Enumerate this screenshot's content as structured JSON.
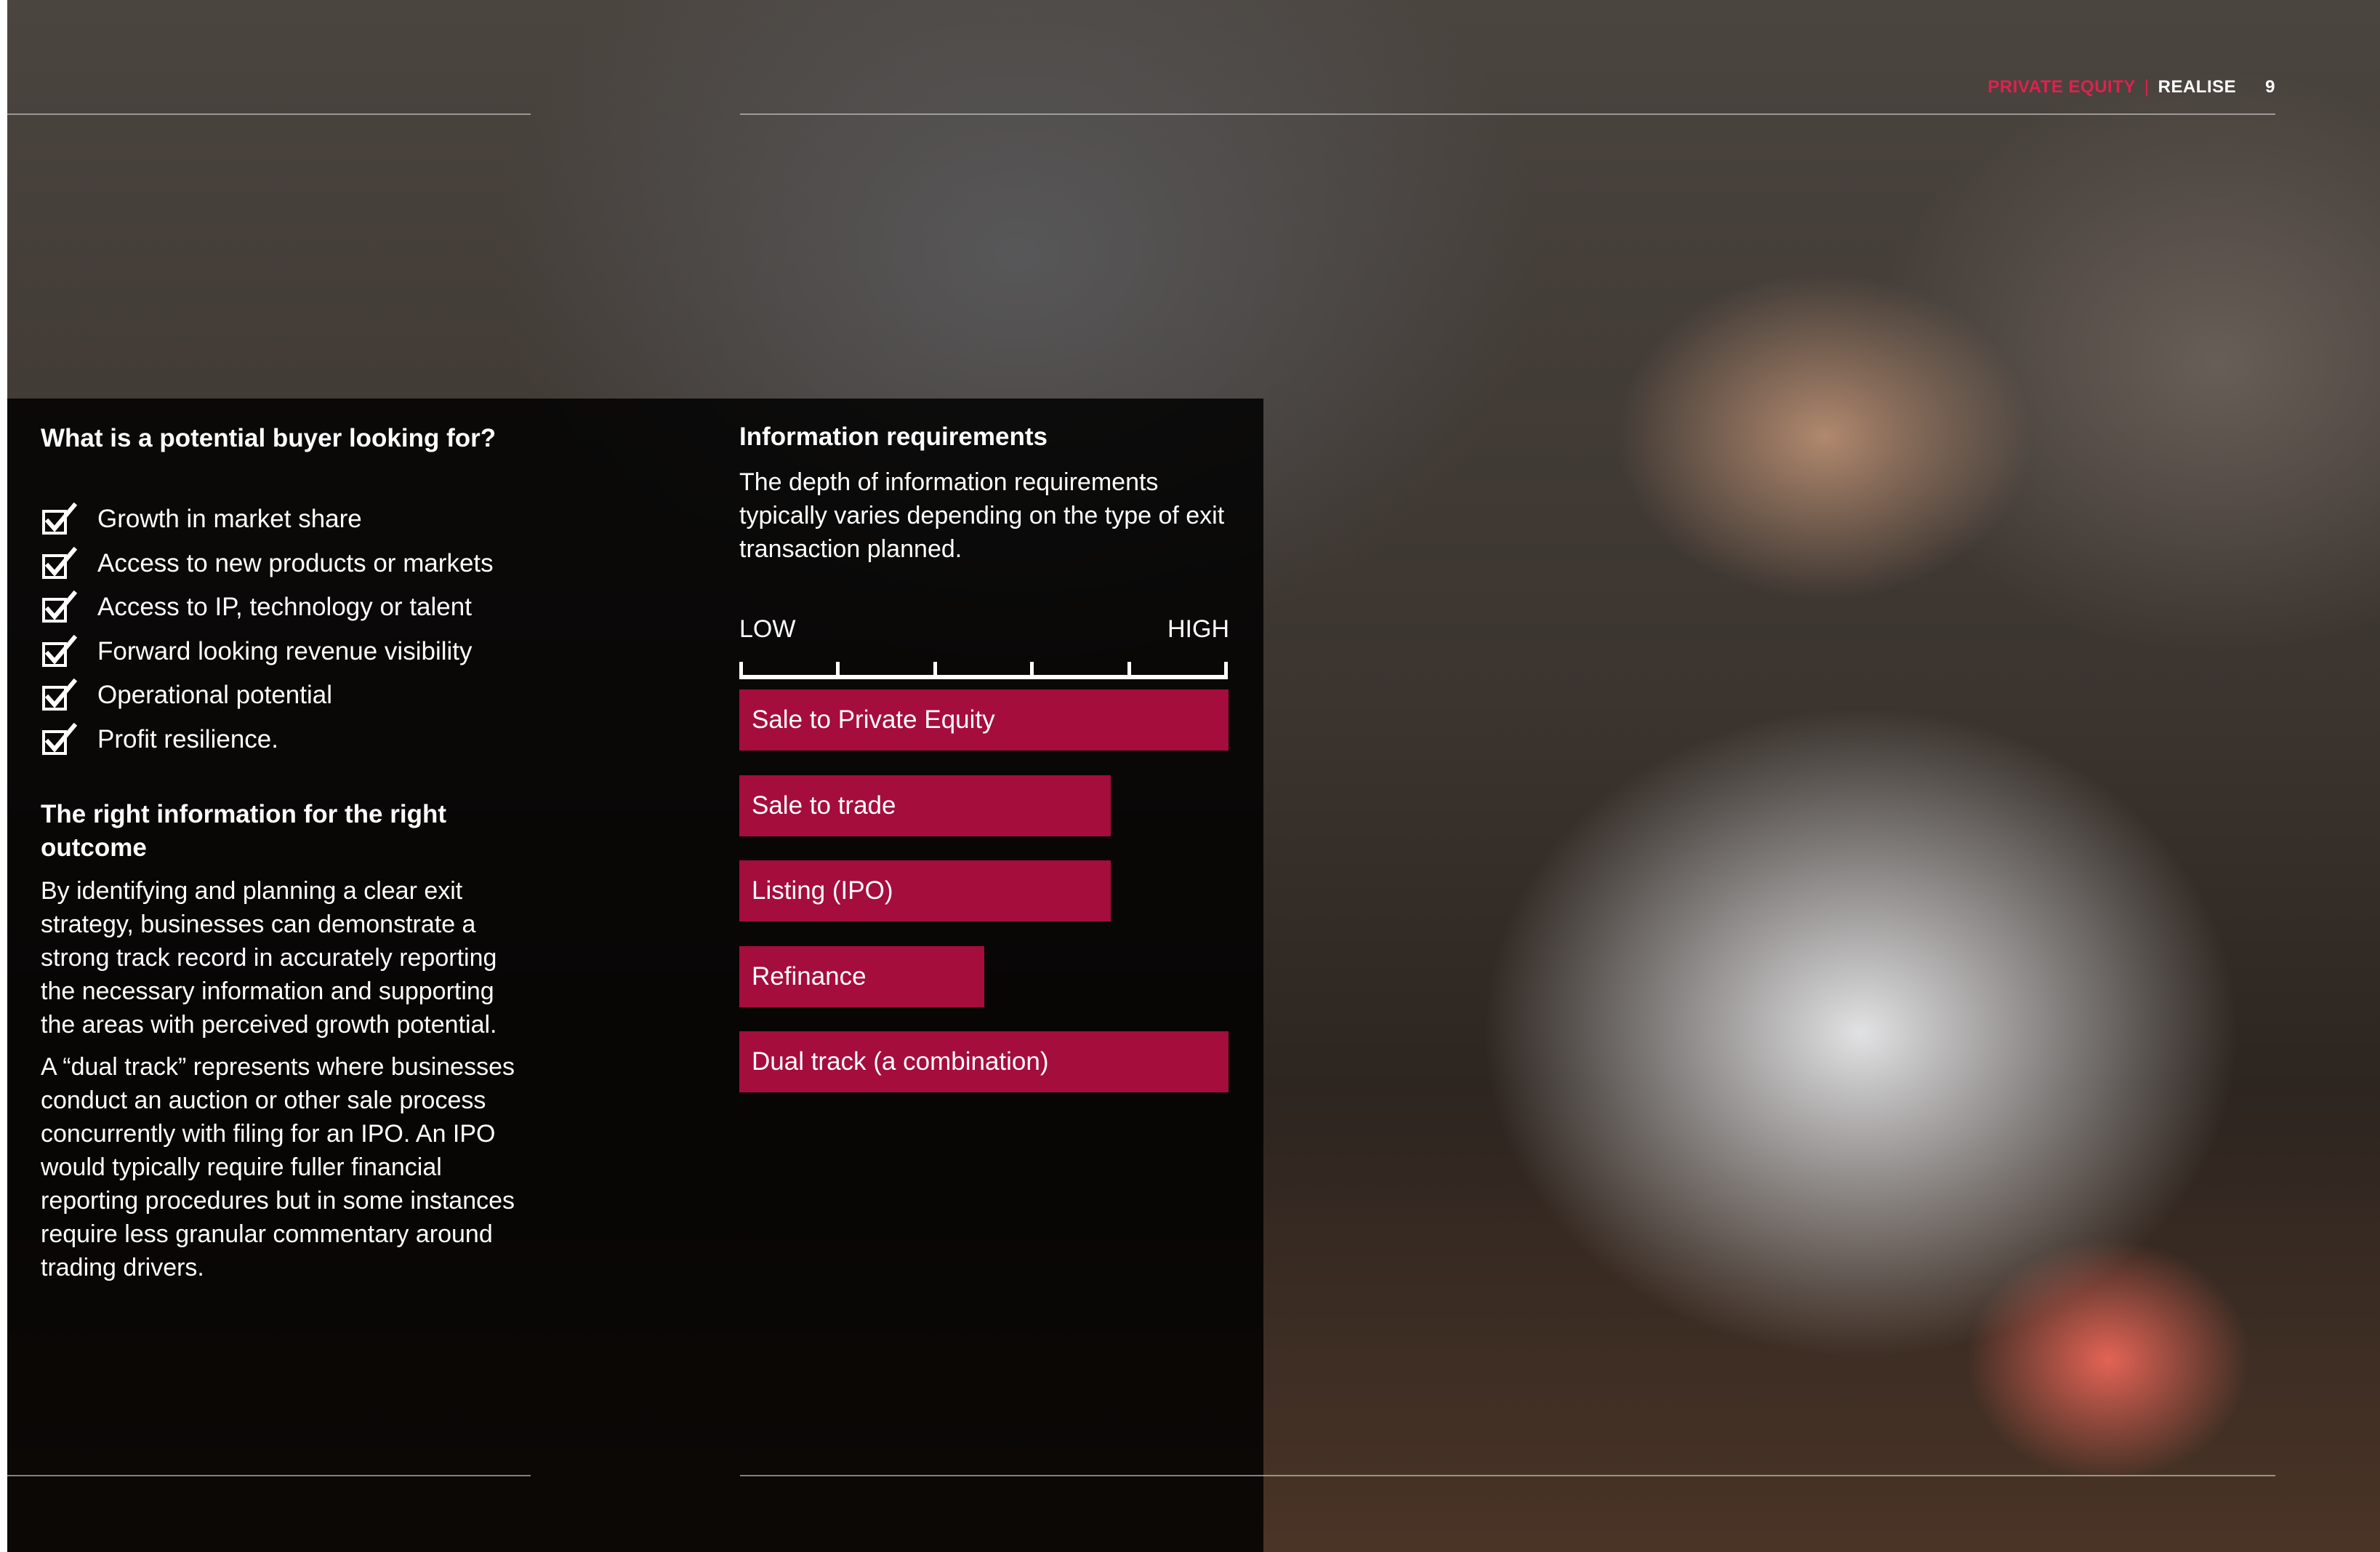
{
  "header": {
    "brand": "PRIVATE EQUITY",
    "separator": "|",
    "section": "REALISE",
    "page_number": "9"
  },
  "buyer": {
    "heading": "What is a potential buyer looking for?",
    "items": [
      "Growth in market share",
      "Access to new products or markets",
      "Access to IP, technology or talent",
      "Forward looking revenue visibility",
      "Operational potential",
      "Profit resilience."
    ]
  },
  "right_info": {
    "heading": "The right information for the right outcome",
    "paragraph1": "By identifying and planning a clear exit strategy, businesses can demonstrate a strong track record in accurately reporting the necessary information and supporting the areas with perceived growth potential.",
    "paragraph2": "A “dual track” represents where businesses conduct an auction or other sale process concurrently with filing for an IPO. An IPO would typically require fuller financial reporting procedures but in some instances require less granular commentary around trading drivers."
  },
  "requirements": {
    "heading": "Information requirements",
    "description": "The depth of information requirements typically varies depending on the type of exit transaction planned.",
    "scale_low": "LOW",
    "scale_high": "HIGH"
  },
  "chart_data": {
    "type": "bar",
    "orientation": "horizontal",
    "categories": [
      "Sale to Private Equity",
      "Sale to trade",
      "Listing (IPO)",
      "Refinance",
      "Dual track (a combination)"
    ],
    "values": [
      5,
      3.8,
      3.8,
      2.5,
      5
    ],
    "xlim": [
      0,
      5
    ],
    "xlabel_low": "LOW",
    "xlabel_high": "HIGH",
    "bar_color": "#a50d3c"
  },
  "colors": {
    "accent": "#e0204f",
    "bar": "#a50d3c"
  }
}
